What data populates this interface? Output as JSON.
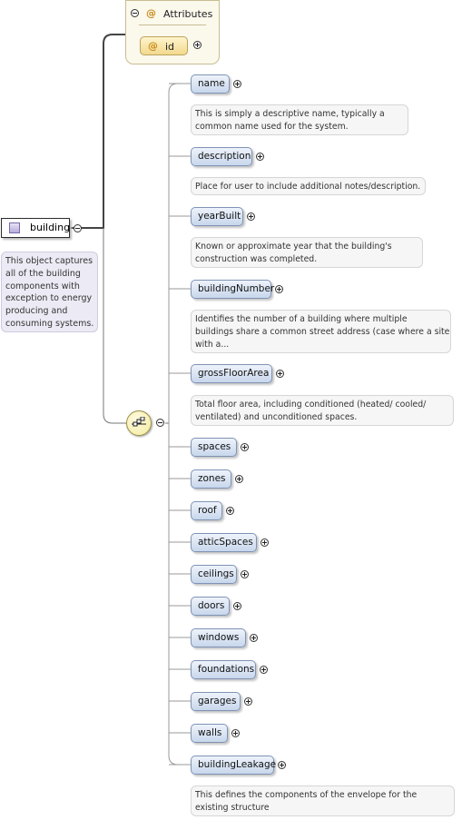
{
  "root": {
    "name": "building",
    "documentation": [
      "This object captures",
      "all of the building",
      "components with",
      "exception to energy",
      "producing and",
      "consuming systems."
    ]
  },
  "attributes": {
    "title": "Attributes",
    "at_symbol": "@",
    "items": [
      "id"
    ]
  },
  "compositor": {
    "type": "sequence",
    "icon": "sequence-icon"
  },
  "children": [
    {
      "name": "name",
      "documentation": [
        "This is simply a descriptive name, typically a",
        "common name used for the system."
      ]
    },
    {
      "name": "description",
      "documentation": [
        "Place for user to include additional notes/description."
      ]
    },
    {
      "name": "yearBuilt",
      "documentation": [
        "Known or approximate year that the building's",
        "construction was completed."
      ]
    },
    {
      "name": "buildingNumber",
      "documentation": [
        "Identifies the number of a building where multiple",
        "buildings share a common street address (case where a site",
        "with a..."
      ]
    },
    {
      "name": "grossFloorArea",
      "documentation": [
        "Total floor area, including conditioned (heated/ cooled/",
        "ventilated) and unconditioned spaces."
      ]
    },
    {
      "name": "spaces",
      "documentation": []
    },
    {
      "name": "zones",
      "documentation": []
    },
    {
      "name": "roof",
      "documentation": []
    },
    {
      "name": "atticSpaces",
      "documentation": []
    },
    {
      "name": "ceilings",
      "documentation": []
    },
    {
      "name": "doors",
      "documentation": []
    },
    {
      "name": "windows",
      "documentation": []
    },
    {
      "name": "foundations",
      "documentation": []
    },
    {
      "name": "garages",
      "documentation": []
    },
    {
      "name": "walls",
      "documentation": []
    },
    {
      "name": "buildingLeakage",
      "documentation": [
        "This defines the components of the envelope for the",
        "existing structure"
      ]
    }
  ],
  "colors": {
    "element_fill_top": "#eef3fb",
    "element_fill_bottom": "#c8d7ec",
    "element_border": "#7f93b5",
    "attribute_fill": "#f2d98e",
    "connector": "#555555"
  }
}
